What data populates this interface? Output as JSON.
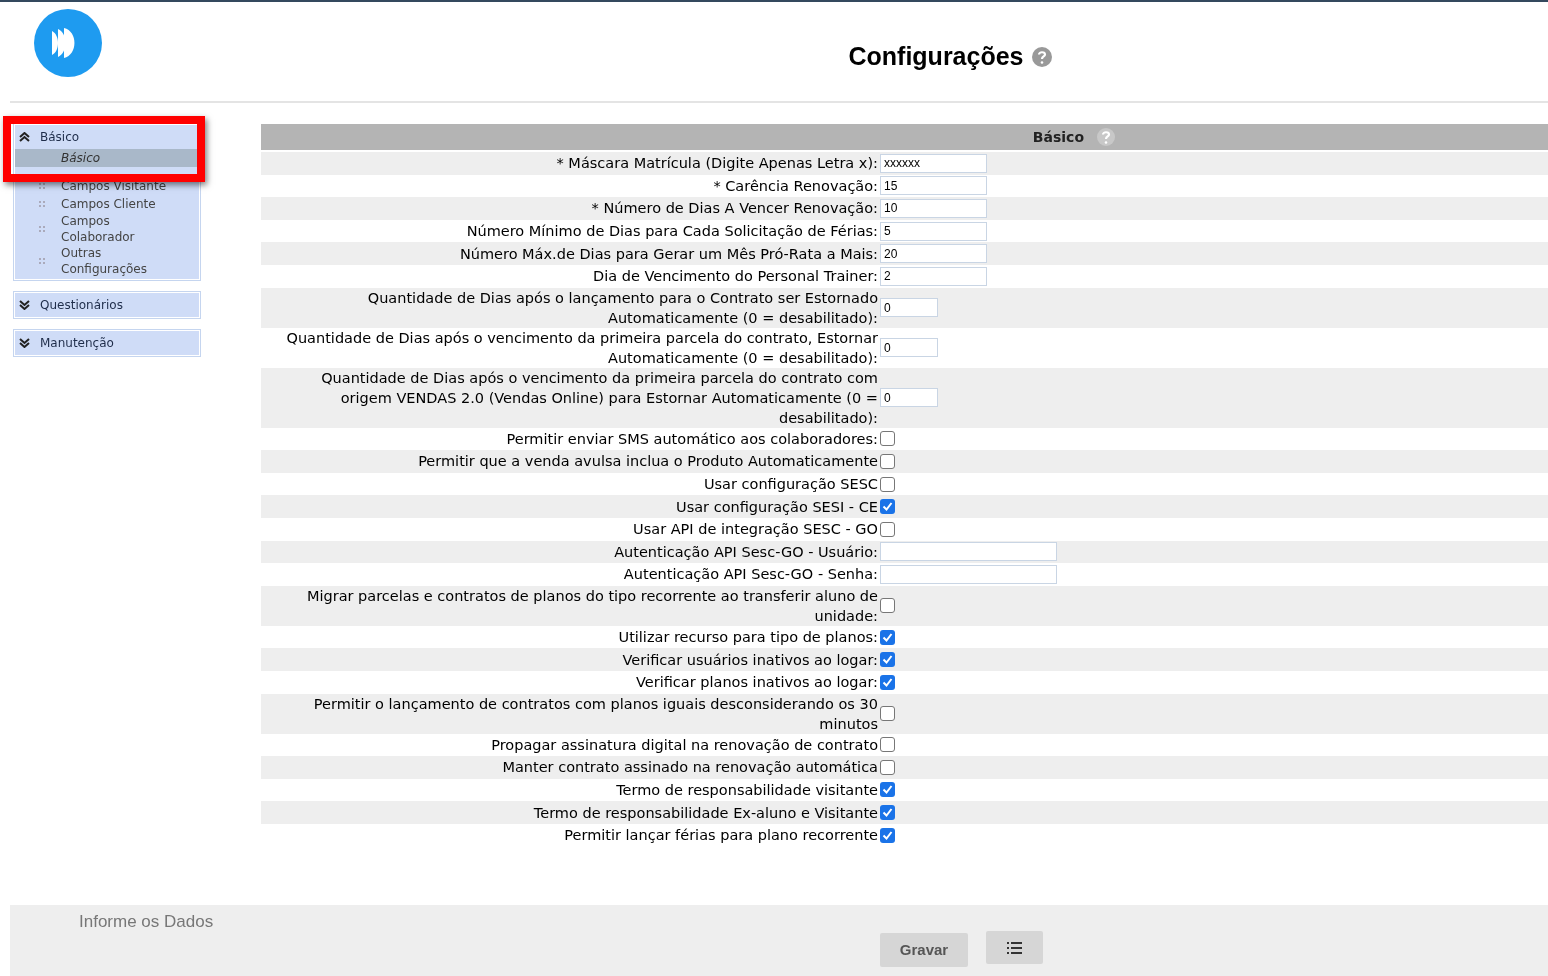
{
  "header": {
    "title": "Configurações"
  },
  "sidebar": {
    "groups": [
      {
        "label": "Básico",
        "expanded": true,
        "items": [
          {
            "label": "Básico",
            "selected": true
          },
          {
            "label": "Campos Visitante",
            "selected": false
          },
          {
            "label": "Campos Cliente",
            "selected": false
          },
          {
            "label": "Campos Colaborador",
            "selected": false
          },
          {
            "label": "Outras Configurações",
            "selected": false
          }
        ]
      },
      {
        "label": "Questionários",
        "expanded": false
      },
      {
        "label": "Manutenção",
        "expanded": false
      }
    ]
  },
  "form": {
    "title": "Básico",
    "rows": [
      {
        "label": "* Máscara Matrícula (Digite Apenas Letra x):",
        "kind": "input",
        "value": "xxxxxx"
      },
      {
        "label": "* Carência Renovação:",
        "kind": "input",
        "value": "15"
      },
      {
        "label": "* Número de Dias A Vencer Renovação:",
        "kind": "input",
        "value": "10"
      },
      {
        "label": "Número Mínimo de Dias para Cada Solicitação de Férias:",
        "kind": "input",
        "value": "5"
      },
      {
        "label": "Número Máx.de Dias para Gerar um Mês Pró-Rata a Mais:",
        "kind": "input",
        "value": "20"
      },
      {
        "label": "Dia de Vencimento do Personal Trainer:",
        "kind": "input",
        "value": "2"
      },
      {
        "label": "Quantidade de Dias após o lançamento para o Contrato ser Estornado Automaticamente (0 = desabilitado):",
        "kind": "small",
        "value": "0"
      },
      {
        "label": "Quantidade de Dias após o vencimento da primeira parcela do contrato, Estornar Automaticamente (0 = desabilitado):",
        "kind": "small",
        "value": "0"
      },
      {
        "label": "Quantidade de Dias após o vencimento da primeira parcela do contrato com origem VENDAS 2.0 (Vendas Online) para Estornar Automaticamente (0 = desabilitado):",
        "kind": "small",
        "value": "0"
      },
      {
        "label": "Permitir enviar SMS automático aos colaboradores:",
        "kind": "checkbox",
        "checked": false
      },
      {
        "label": "Permitir que a venda avulsa inclua o Produto Automaticamente",
        "kind": "checkbox",
        "checked": false
      },
      {
        "label": "Usar configuração SESC",
        "kind": "checkbox",
        "checked": false
      },
      {
        "label": "Usar configuração SESI - CE",
        "kind": "checkbox",
        "checked": true
      },
      {
        "label": "Usar API de integração SESC - GO",
        "kind": "checkbox",
        "checked": false
      },
      {
        "label": "Autenticação API Sesc-GO - Usuário:",
        "kind": "wide"
      },
      {
        "label": "Autenticação API Sesc-GO - Senha:",
        "kind": "wide"
      },
      {
        "label": "Migrar parcelas e contratos de planos do tipo recorrente ao transferir aluno de unidade:",
        "kind": "checkbox",
        "checked": false
      },
      {
        "label": "Utilizar recurso para tipo de planos:",
        "kind": "checkbox",
        "checked": true
      },
      {
        "label": "Verificar usuários inativos ao logar:",
        "kind": "checkbox",
        "checked": true
      },
      {
        "label": "Verificar planos inativos ao logar:",
        "kind": "checkbox",
        "checked": true
      },
      {
        "label": "Permitir o lançamento de contratos com planos iguais desconsiderando os 30 minutos",
        "kind": "checkbox",
        "checked": false
      },
      {
        "label": "Propagar assinatura digital na renovação de contrato",
        "kind": "checkbox",
        "checked": false
      },
      {
        "label": "Manter contrato assinado na renovação automática",
        "kind": "checkbox",
        "checked": false
      },
      {
        "label": "Termo de responsabilidade visitante",
        "kind": "checkbox",
        "checked": true
      },
      {
        "label": "Termo de responsabilidade Ex-aluno e Visitante",
        "kind": "checkbox",
        "checked": true
      },
      {
        "label": "Permitir lançar férias para plano recorrente",
        "kind": "checkbox",
        "checked": true
      }
    ]
  },
  "footer": {
    "message": "Informe os Dados",
    "save_button": "Gravar"
  }
}
